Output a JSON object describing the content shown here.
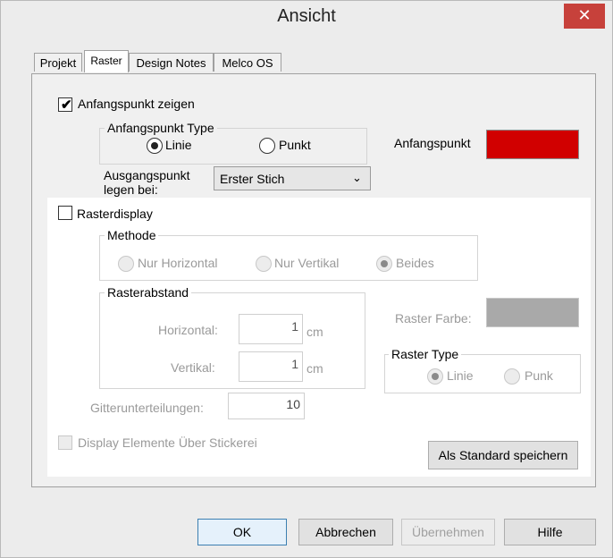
{
  "window": {
    "title": "Ansicht",
    "close_glyph": "✕"
  },
  "tabs": [
    {
      "label": "Projekt",
      "active": false
    },
    {
      "label": "Raster",
      "active": true
    },
    {
      "label": "Design Notes",
      "active": false
    },
    {
      "label": "Melco OS",
      "active": false
    }
  ],
  "origin": {
    "show_label": "Anfangspunkt zeigen",
    "show_checked": true,
    "type_group_label": "Anfangspunkt Type",
    "type_options": [
      {
        "label": "Linie",
        "selected": true
      },
      {
        "label": "Punkt",
        "selected": false
      }
    ],
    "color_label": "Anfangspunkt",
    "color": "#d10000",
    "place_label_line1": "Ausgangspunkt",
    "place_label_line2": "legen bei:",
    "place_value": "Erster Stich",
    "dropdown_icon": "chevron-down-icon"
  },
  "grid": {
    "display_label": "Rasterdisplay",
    "display_checked": false,
    "method_group_label": "Methode",
    "method_options": [
      {
        "label": "Nur Horizontal",
        "selected": false
      },
      {
        "label": "Nur Vertikal",
        "selected": false
      },
      {
        "label": "Beides",
        "selected": true
      }
    ],
    "spacing_group_label": "Rasterabstand",
    "horizontal_label": "Horizontal:",
    "horizontal_value": "1",
    "horizontal_unit": "cm",
    "vertical_label": "Vertikal:",
    "vertical_value": "1",
    "vertical_unit": "cm",
    "color_label": "Raster Farbe:",
    "color": "#a9a9a9",
    "type_group_label": "Raster Type",
    "type_options": [
      {
        "label": "Linie",
        "selected": true
      },
      {
        "label": "Punk",
        "selected": false
      }
    ],
    "subdivisions_label": "Gitterunterteilungen:",
    "subdivisions_value": "10",
    "elements_over_label": "Display Elemente Über Stickerei",
    "elements_over_checked": false,
    "save_default_label": "Als Standard speichern"
  },
  "footer": {
    "ok_label": "OK",
    "cancel_label": "Abbrechen",
    "apply_label": "Übernehmen",
    "help_label": "Hilfe"
  }
}
